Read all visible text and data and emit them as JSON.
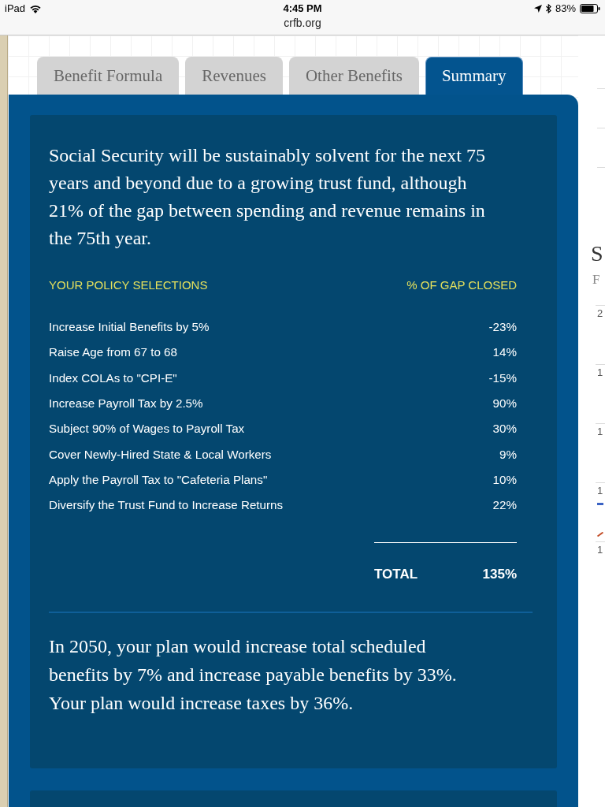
{
  "status_bar": {
    "device": "iPad",
    "time": "4:45 PM",
    "battery": "83%"
  },
  "address_bar": {
    "url": "crfb.org"
  },
  "tabs": [
    {
      "label": "Benefit Formula",
      "selected": false
    },
    {
      "label": "Revenues",
      "selected": false
    },
    {
      "label": "Other Benefits",
      "selected": false
    },
    {
      "label": "Summary",
      "selected": true
    }
  ],
  "summary": {
    "intro": "Social Security will be sustainably solvent for the next 75 years and beyond due to a growing trust fund, although 21% of the gap between spending and revenue remains in the 75th year.",
    "columns": [
      "YOUR POLICY SELECTIONS",
      "% OF GAP CLOSED"
    ],
    "rows": [
      {
        "policy": "Increase Initial Benefits by 5%",
        "gap_closed": "-23%"
      },
      {
        "policy": "Raise Age from 67 to 68",
        "gap_closed": "14%"
      },
      {
        "policy": "Index COLAs to \"CPI-E\"",
        "gap_closed": "-15%"
      },
      {
        "policy": "Increase Payroll Tax by 2.5%",
        "gap_closed": "90%"
      },
      {
        "policy": "Subject 90% of Wages to Payroll Tax",
        "gap_closed": "30%"
      },
      {
        "policy": "Cover Newly-Hired State & Local Workers",
        "gap_closed": "9%"
      },
      {
        "policy": "Apply the Payroll Tax to \"Cafeteria Plans\"",
        "gap_closed": "10%"
      },
      {
        "policy": "Diversify the Trust Fund to Increase Returns",
        "gap_closed": "22%"
      }
    ],
    "total": {
      "label": "TOTAL",
      "value": "135%"
    },
    "outcome": "In 2050, your plan would increase total scheduled benefits by 7% and increase payable benefits by 33%. Your plan would increase taxes by 36%."
  },
  "side_panel": {
    "heading": "S",
    "subheading": "F",
    "rows": [
      {
        "value": "2"
      },
      {
        "value": "1"
      },
      {
        "value": "1"
      },
      {
        "value": "1",
        "markers": [
          {
            "color": "#3b63c4"
          },
          {
            "color": "#c4502b"
          }
        ]
      },
      {
        "value": "1"
      }
    ]
  }
}
